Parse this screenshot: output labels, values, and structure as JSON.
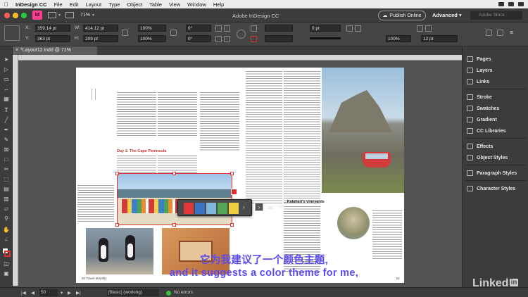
{
  "menubar": {
    "app": "InDesign CC",
    "items": [
      "File",
      "Edit",
      "Layout",
      "Type",
      "Object",
      "Table",
      "View",
      "Window",
      "Help"
    ]
  },
  "appbar": {
    "badge": "Id",
    "zoom": "71%",
    "title": "Adobe InDesign CC",
    "publish": "Publish Online",
    "workspace": "Advanced",
    "stock_placeholder": "Adobe Stock"
  },
  "control": {
    "x_label": "X:",
    "x_value": "359.14 pt",
    "y_label": "Y:",
    "y_value": "363 pt",
    "w_label": "W:",
    "w_value": "414.12 pt",
    "h_label": "H:",
    "h_value": "209 pt",
    "scale_x": "100%",
    "scale_y": "100%",
    "angle": "0°",
    "shear": "0°",
    "stroke_weight": "0 pt",
    "ref_pct": "100%",
    "field_pt": "12 pt"
  },
  "document": {
    "tab": "*Layout12.indd @ 71%",
    "page_left_footer": "50",
    "page_left_footer_text": "Travel Monthly",
    "page_right_footer": "51",
    "heading_left": "Day 1: The Cape Peninsula",
    "heading_right": "...Kalahari's vineyards"
  },
  "panels": {
    "items": [
      "Pages",
      "Layers",
      "Links",
      "Stroke",
      "Swatches",
      "Gradient",
      "CC Libraries",
      "Effects",
      "Object Styles",
      "Paragraph Styles",
      "Character Styles"
    ]
  },
  "status": {
    "page": "50",
    "style": "[Basic] (working)",
    "errors": "No errors"
  },
  "popup": {
    "colors": [
      "#e2353c",
      "#3a72c4",
      "#83b6de",
      "#53a653",
      "#f0d040"
    ]
  },
  "subtitles": {
    "chinese": "它为我建议了一个颜色主题,",
    "english": "and it suggests a color theme for me,"
  },
  "watermark": {
    "text": "Linked",
    "in": "in"
  },
  "colors": {
    "accent": "#fd3f92",
    "subtitle": "#5a4cf0"
  }
}
